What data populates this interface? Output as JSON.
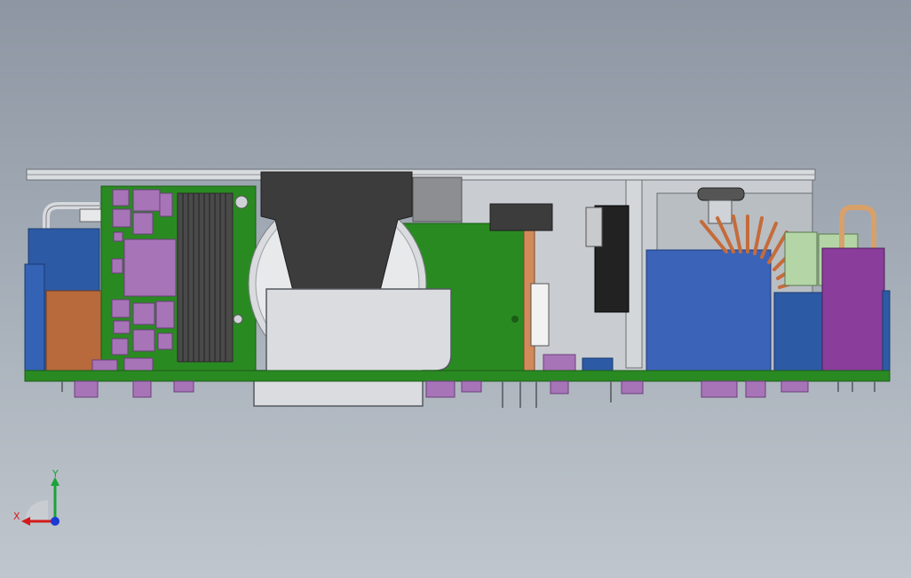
{
  "viewport": {
    "background_top": "#8d96a2",
    "background_bottom": "#c0c6cd"
  },
  "colors": {
    "pcb_green": "#2a8a22",
    "pcb_dark": "#1f6d1a",
    "ic_purple": "#a774b8",
    "cap_blue": "#2d5aa5",
    "cap_copper": "#b86a3c",
    "heatsink_dark": "#3c3c3c",
    "enclosure_grey": "#cfd2d6",
    "transformer_blue": "#3b63b8",
    "capacitor_purple": "#8a3d9a",
    "toroid_copper": "#c56b3a",
    "axis_x": "#d41a1a",
    "axis_y": "#1aa33a",
    "axis_z": "#1a3ad4"
  },
  "triad": {
    "x_label": "X",
    "y_label": "Y",
    "icon": "coordinate-triad-icon"
  }
}
